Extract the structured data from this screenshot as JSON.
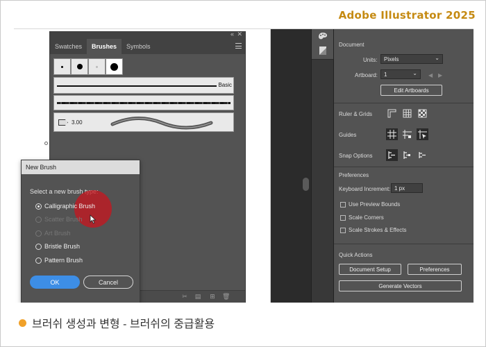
{
  "brand": "Adobe Illustrator 2025",
  "caption": "브러쉬 생성과 변형 - 브러쉬의 중급활용",
  "colors": {
    "brand": "#c58a12",
    "bullet": "#f0a12a",
    "highlight": "#c8141e",
    "ok_button": "#3d8ee6"
  },
  "brushes_panel": {
    "tabs": [
      "Swatches",
      "Brushes",
      "Symbols"
    ],
    "active_tab": "Brushes",
    "basic_label": "Basic",
    "art_value": "3.00",
    "footer_icons": [
      "brush-libraries-icon",
      "remove-stroke-icon",
      "options-icon",
      "new-brush-icon",
      "delete-brush-icon"
    ]
  },
  "new_brush_dialog": {
    "title": "New Brush",
    "prompt": "Select a new brush type:",
    "options": [
      {
        "label": "Calligraphic Brush",
        "selected": true,
        "enabled": true
      },
      {
        "label": "Scatter Brush",
        "selected": false,
        "enabled": false
      },
      {
        "label": "Art Brush",
        "selected": false,
        "enabled": false
      },
      {
        "label": "Bristle Brush",
        "selected": false,
        "enabled": true
      },
      {
        "label": "Pattern Brush",
        "selected": false,
        "enabled": true
      }
    ],
    "ok_label": "OK",
    "cancel_label": "Cancel"
  },
  "properties": {
    "document_heading": "Document",
    "units_label": "Units:",
    "units_value": "Pixels",
    "artboard_label": "Artboard:",
    "artboard_value": "1",
    "edit_artboards_label": "Edit Artboards",
    "ruler_grids_label": "Ruler & Grids",
    "guides_label": "Guides",
    "snap_options_label": "Snap Options",
    "preferences_heading": "Preferences",
    "keyboard_increment_label": "Keyboard Increment:",
    "keyboard_increment_value": "1 px",
    "use_preview_bounds_label": "Use Preview Bounds",
    "scale_corners_label": "Scale Corners",
    "scale_strokes_label": "Scale Strokes & Effects",
    "quick_actions_heading": "Quick Actions",
    "document_setup_label": "Document Setup",
    "preferences_button_label": "Preferences",
    "generate_vectors_label": "Generate Vectors"
  }
}
